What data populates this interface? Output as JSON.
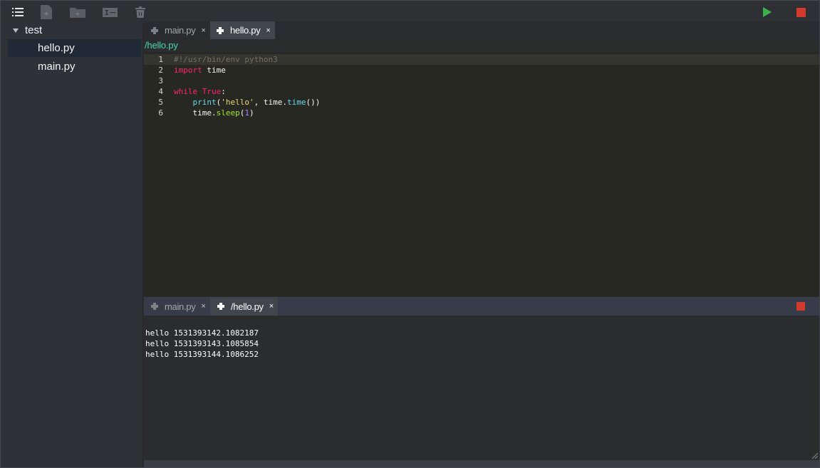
{
  "toolbar": {
    "buttons": [
      "list-icon",
      "new-file-icon",
      "new-folder-icon",
      "rename-icon",
      "delete-icon"
    ],
    "run_icon": "play-icon",
    "stop_icon": "stop-icon",
    "colors": {
      "run": "#3cb34a",
      "stop": "#d23a2e"
    }
  },
  "sidebar": {
    "root": {
      "label": "test",
      "icon": "caret-down-icon"
    },
    "files": [
      {
        "label": "hello.py",
        "active": true
      },
      {
        "label": "main.py",
        "active": false
      }
    ]
  },
  "editor_tabs": [
    {
      "label": "main.py",
      "close": "×",
      "active": false
    },
    {
      "label": "hello.py",
      "close": "×",
      "active": true
    }
  ],
  "editor": {
    "path": "/hello.py",
    "line_numbers": [
      "1",
      "2",
      "3",
      "4",
      "5",
      "6"
    ],
    "lines": [
      [
        {
          "t": "#!/usr/bin/env python3",
          "c": "comment"
        }
      ],
      [
        {
          "t": "import",
          "c": "kw"
        },
        {
          "t": " time",
          "c": "plain"
        }
      ],
      [],
      [
        {
          "t": "while",
          "c": "kw"
        },
        {
          "t": " ",
          "c": "plain"
        },
        {
          "t": "True",
          "c": "kw"
        },
        {
          "t": ":",
          "c": "plain"
        }
      ],
      [
        {
          "t": "    ",
          "c": "plain"
        },
        {
          "t": "print",
          "c": "fn"
        },
        {
          "t": "(",
          "c": "plain"
        },
        {
          "t": "'hello'",
          "c": "str"
        },
        {
          "t": ", time.",
          "c": "plain"
        },
        {
          "t": "time",
          "c": "fn"
        },
        {
          "t": "())",
          "c": "plain"
        }
      ],
      [
        {
          "t": "    time.",
          "c": "plain"
        },
        {
          "t": "sleep",
          "c": "method"
        },
        {
          "t": "(",
          "c": "plain"
        },
        {
          "t": "1",
          "c": "const"
        },
        {
          "t": ")",
          "c": "plain"
        }
      ]
    ]
  },
  "terminal_tabs": [
    {
      "label": "main.py",
      "close": "×",
      "active": false
    },
    {
      "label": "/hello.py",
      "close": "×",
      "active": true
    }
  ],
  "terminal": {
    "lines": [
      "hello 1531393142.1082187",
      "hello 1531393143.1085854",
      "hello 1531393144.1086252"
    ]
  }
}
